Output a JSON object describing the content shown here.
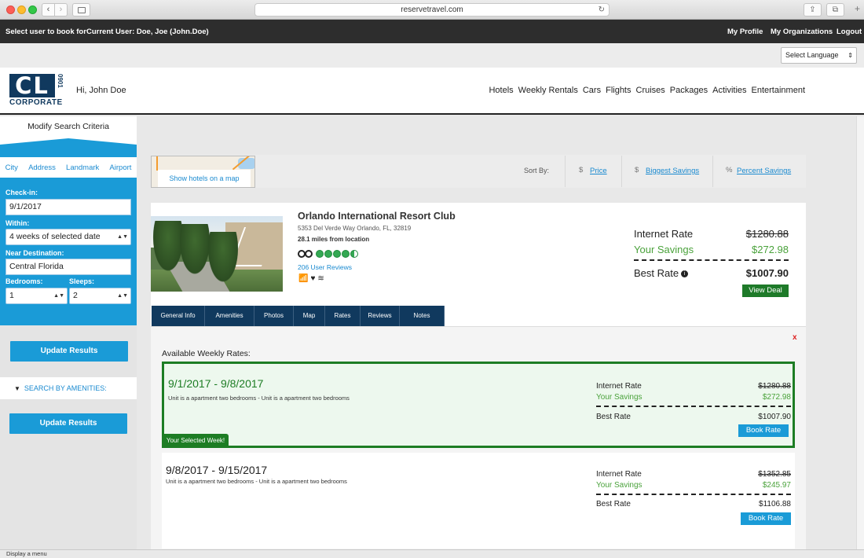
{
  "browser": {
    "url": "reservetravel.com",
    "back_icon": "chevron-left-icon",
    "forward_icon": "chevron-right-icon"
  },
  "topbar": {
    "select_user": "Select user to book for",
    "current_user": "Current User: Doe, Joe (John.Doe)",
    "my_profile": "My Profile",
    "my_organizations": "My Organizations",
    "logout": "Logout"
  },
  "language": {
    "selected": "Select Language"
  },
  "header": {
    "logo_letters": "CL",
    "logo_number": "0901",
    "logo_word": "CORPORATE",
    "greeting": "Hi, John Doe",
    "nav": [
      "Hotels",
      "Weekly Rentals",
      "Cars",
      "Flights",
      "Cruises",
      "Packages",
      "Activities",
      "Entertainment"
    ]
  },
  "search": {
    "title": "Modify Search Criteria",
    "location_tabs": [
      "City",
      "Address",
      "Landmark",
      "Airport"
    ],
    "checkin_label": "Check-in:",
    "checkin_value": "9/1/2017",
    "within_label": "Within:",
    "within_value": "4 weeks of selected date",
    "destination_label": "Near Destination:",
    "destination_value": "Central Florida",
    "bedrooms_label": "Bedrooms:",
    "bedrooms_value": "1",
    "sleeps_label": "Sleeps:",
    "sleeps_value": "2",
    "update_button": "Update Results",
    "amenities_label": "SEARCH BY AMENITIES:"
  },
  "sort": {
    "map_link": "Show hotels on a map",
    "label": "Sort By:",
    "price_icon": "$",
    "price": "Price",
    "savings_icon": "$",
    "savings": "Biggest Savings",
    "percent_icon": "%",
    "percent": "Percent Savings"
  },
  "hotel": {
    "name": "Orlando International Resort Club",
    "address": "5353 Del Verde Way Orlando, FL, 32819",
    "distance": "28.1 miles from location",
    "reviews": "206 User Reviews",
    "rating_bubbles": 4.5,
    "amenity_icons": [
      "wifi-icon",
      "heart-rate-icon",
      "swimming-icon"
    ],
    "internet_rate_label": "Internet Rate",
    "internet_rate": "$1280.88",
    "savings_label": "Your Savings",
    "savings": "$272.98",
    "best_rate_label": "Best Rate",
    "best_rate": "$1007.90",
    "view_deal": "View Deal",
    "tabs": [
      "General Info",
      "Amenities",
      "Photos",
      "Map",
      "Rates",
      "Reviews",
      "Notes"
    ]
  },
  "rates": {
    "title": "Available Weekly Rates:",
    "close": "x",
    "weeks": [
      {
        "dates": "9/1/2017 - 9/8/2017",
        "desc": "Unit is a apartment two bedrooms - Unit is a apartment two bedrooms",
        "internet_label": "Internet Rate",
        "internet": "$1280.88",
        "savings_label": "Your Savings",
        "savings": "$272.98",
        "best_label": "Best Rate",
        "best": "$1007.90",
        "book": "Book Rate",
        "tag": "Your Selected Week!"
      },
      {
        "dates": "9/8/2017 - 9/15/2017",
        "desc": "Unit is a apartment two bedrooms - Unit is a apartment two bedrooms",
        "internet_label": "Internet Rate",
        "internet": "$1352.85",
        "savings_label": "Your Savings",
        "savings": "$245.97",
        "best_label": "Best Rate",
        "best": "$1106.88",
        "book": "Book Rate"
      }
    ]
  },
  "status": "Display a menu",
  "colors": {
    "brand_navy": "#10395e",
    "accent_blue": "#1a9bd7",
    "deal_green": "#1e7a29",
    "savings_green": "#4aa23b"
  }
}
